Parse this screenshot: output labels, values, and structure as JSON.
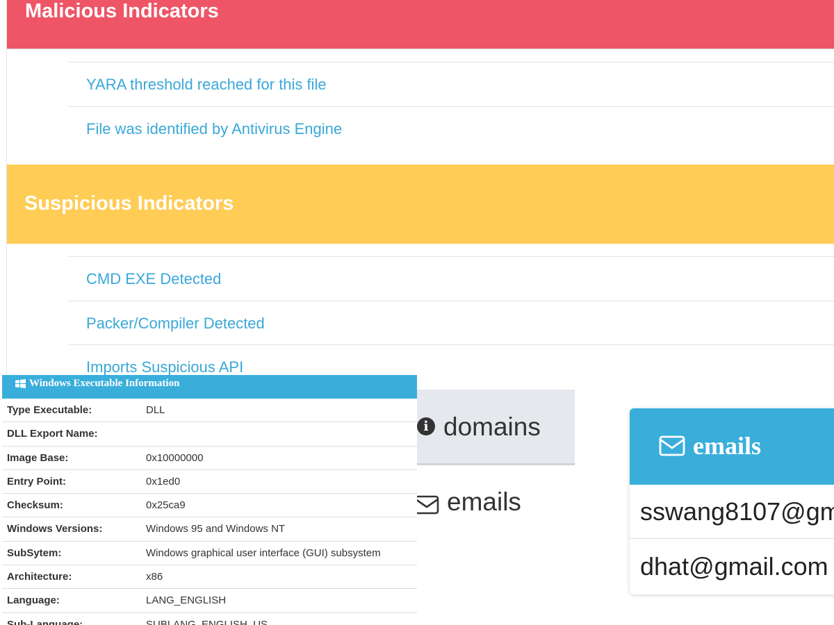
{
  "malicious": {
    "title": "Malicious Indicators",
    "items": [
      "YARA threshold reached for this file",
      "File was identified by Antivirus Engine"
    ]
  },
  "suspicious": {
    "title": "Suspicious Indicators",
    "items": [
      "CMD EXE Detected",
      "Packer/Compiler Detected",
      "Imports Suspicious API"
    ]
  },
  "tabs": {
    "domains_label": "domains",
    "emails_label": "emails",
    "info_icon": "info-icon",
    "envelope_icon": "envelope-icon"
  },
  "email_card": {
    "title": "emails",
    "emails": [
      "sswang8107@gm",
      "dhat@gmail.com"
    ]
  },
  "win_exe": {
    "title": "Windows Executable Information",
    "rows": [
      {
        "key": "Type Executable:",
        "value": "DLL"
      },
      {
        "key": "DLL Export Name:",
        "value": ""
      },
      {
        "key": "Image Base:",
        "value": "0x10000000"
      },
      {
        "key": "Entry Point:",
        "value": "0x1ed0"
      },
      {
        "key": "Checksum:",
        "value": "0x25ca9"
      },
      {
        "key": "Windows Versions:",
        "value": "Windows 95 and Windows NT"
      },
      {
        "key": "SubSytem:",
        "value": "Windows graphical user interface (GUI) subsystem"
      },
      {
        "key": "Architecture:",
        "value": "x86"
      },
      {
        "key": "Language:",
        "value": "LANG_ENGLISH"
      },
      {
        "key": "Sub-Language:",
        "value": "SUBLANG_ENGLISH_US"
      }
    ]
  },
  "colors": {
    "malicious": "#ee5566",
    "suspicious": "#ffcc55",
    "link": "#3aa8d8",
    "accent": "#3aaedb"
  }
}
